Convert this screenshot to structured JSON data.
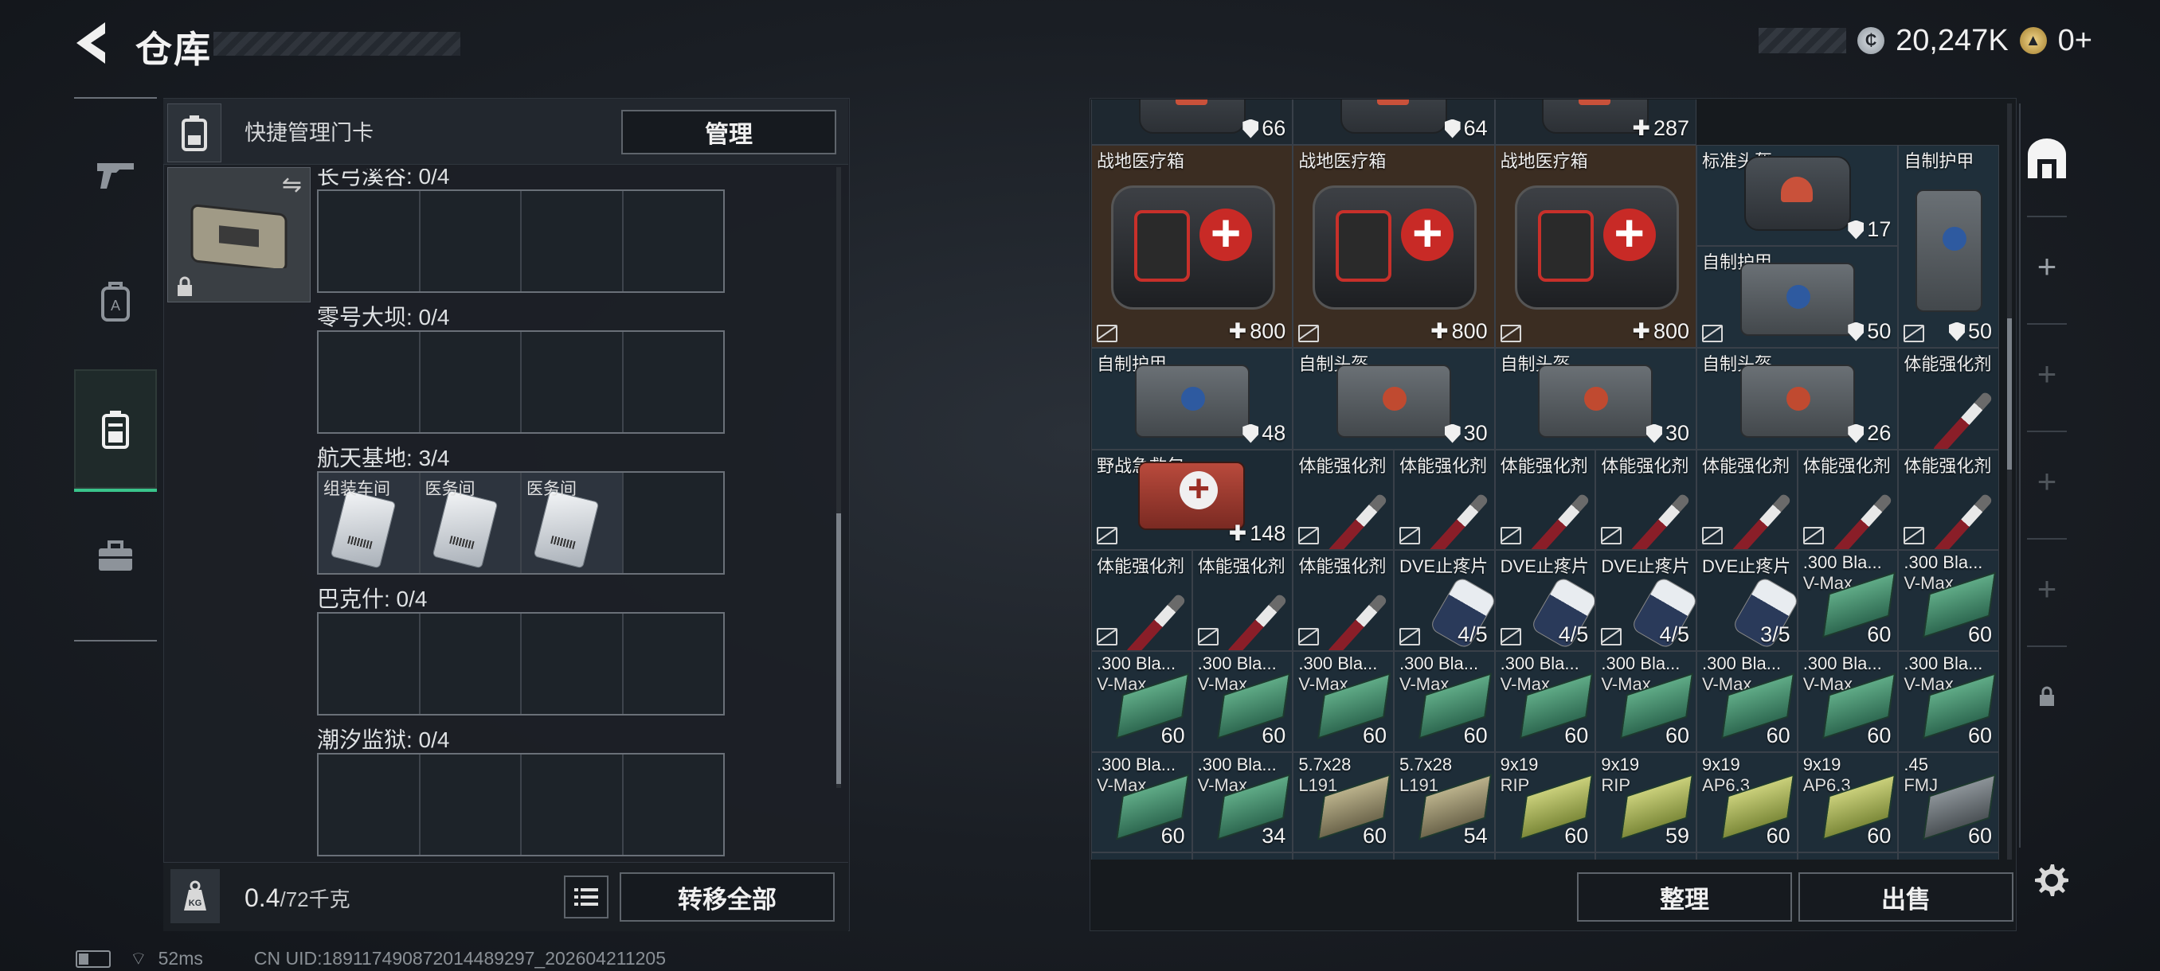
{
  "header": {
    "title": "仓库",
    "silver_value": "20,247K",
    "gold_value": "0+"
  },
  "left_tabs": [
    "gun-icon",
    "backpack-icon",
    "keycard-case-icon",
    "toolbox-icon"
  ],
  "keycard_bar": {
    "label": "快捷管理门卡",
    "manage_label": "管理"
  },
  "maps": [
    {
      "label": "长弓溪谷: 0/4",
      "cells": [
        "",
        "",
        "",
        ""
      ]
    },
    {
      "label": "零号大坝: 0/4",
      "cells": [
        "",
        "",
        "",
        ""
      ]
    },
    {
      "label": "航天基地: 3/4",
      "cells": [
        "组装车间",
        "医务间",
        "医务间",
        ""
      ]
    },
    {
      "label": "巴克什: 0/4",
      "cells": [
        "",
        "",
        "",
        ""
      ]
    },
    {
      "label": "潮汐监狱: 0/4",
      "cells": [
        "",
        "",
        "",
        ""
      ]
    }
  ],
  "bottom_left": {
    "weight_value": "0.4",
    "weight_capacity": "/72千克",
    "transfer_label": "转移全部"
  },
  "status": {
    "ping": "52ms",
    "uid": "CN UID:18911749087201448​9297_202604211205"
  },
  "grid_row0": [
    {
      "type": "top",
      "value": "66",
      "icon": "shield"
    },
    {
      "type": "top",
      "value": "64",
      "icon": "shield"
    },
    {
      "type": "top",
      "value": "287",
      "icon": "plus"
    }
  ],
  "medkits": [
    {
      "name": "战地医疗箱",
      "value": "800"
    },
    {
      "name": "战地医疗箱",
      "value": "800"
    },
    {
      "name": "战地医疗箱",
      "value": "800"
    }
  ],
  "std_helmet": {
    "name": "标准头盔",
    "value": "17"
  },
  "self_armor_small": {
    "name": "自制护甲",
    "value": "50"
  },
  "self_armor_tall": {
    "name": "自制护甲",
    "value": "50"
  },
  "row_armor": [
    {
      "name": "自制护甲",
      "value": "48"
    },
    {
      "name": "自制头盔",
      "value": "30"
    },
    {
      "name": "自制头盔",
      "value": "30"
    },
    {
      "name": "自制头盔",
      "value": "26"
    }
  ],
  "stim_name": "体能强化剂",
  "field_kit": {
    "name": "野战急救包",
    "value": "148"
  },
  "dve": [
    {
      "name": "DVE止疼片",
      "value": "4/5"
    },
    {
      "name": "DVE止疼片",
      "value": "4/5"
    },
    {
      "name": "DVE止疼片",
      "value": "4/5"
    },
    {
      "name": "DVE止疼片",
      "value": "3/5"
    }
  ],
  "ammo_row3": [
    {
      "name": ".300 Bla...",
      "sub": "V-Max",
      "value": "60"
    },
    {
      "name": ".300 Bla...",
      "sub": "V-Max",
      "value": "60"
    }
  ],
  "ammo_row4": [
    {
      "name": ".300 Bla...",
      "sub": "V-Max",
      "value": "60"
    },
    {
      "name": ".300 Bla...",
      "sub": "V-Max",
      "value": "60"
    },
    {
      "name": ".300 Bla...",
      "sub": "V-Max",
      "value": "60"
    },
    {
      "name": ".300 Bla...",
      "sub": "V-Max",
      "value": "60"
    },
    {
      "name": ".300 Bla...",
      "sub": "V-Max",
      "value": "60"
    },
    {
      "name": ".300 Bla...",
      "sub": "V-Max",
      "value": "60"
    },
    {
      "name": ".300 Bla...",
      "sub": "V-Max",
      "value": "60"
    },
    {
      "name": ".300 Bla...",
      "sub": "V-Max",
      "value": "60"
    },
    {
      "name": ".300 Bla...",
      "sub": "V-Max",
      "value": "60"
    }
  ],
  "ammo_row5": [
    {
      "name": ".300 Bla...",
      "sub": "V-Max",
      "value": "60",
      "box": ""
    },
    {
      "name": ".300 Bla...",
      "sub": "V-Max",
      "value": "34",
      "box": ""
    },
    {
      "name": "5.7x28",
      "sub": "L191",
      "value": "60",
      "box": "sand"
    },
    {
      "name": "5.7x28",
      "sub": "L191",
      "value": "54",
      "box": "sand"
    },
    {
      "name": "9x19",
      "sub": "RIP",
      "value": "60",
      "box": "yellow"
    },
    {
      "name": "9x19",
      "sub": "RIP",
      "value": "59",
      "box": "yellow"
    },
    {
      "name": "9x19",
      "sub": "AP6.3",
      "value": "60",
      "box": "yellow"
    },
    {
      "name": "9x19",
      "sub": "AP6.3",
      "value": "60",
      "box": "yellow"
    },
    {
      "name": ".45",
      "sub": "FMJ",
      "value": "60",
      "box": "gray"
    }
  ],
  "actions": {
    "sort_label": "整理",
    "sell_label": "出售"
  },
  "right_tabs": [
    "storage-icon",
    "add-icon",
    "add-icon",
    "add-icon",
    "add-icon",
    "lock-icon"
  ],
  "colors": {
    "accent_green": "#39c48b",
    "medkit_bg": "#3b2d22",
    "armor_bg": "#1f2f3a"
  }
}
